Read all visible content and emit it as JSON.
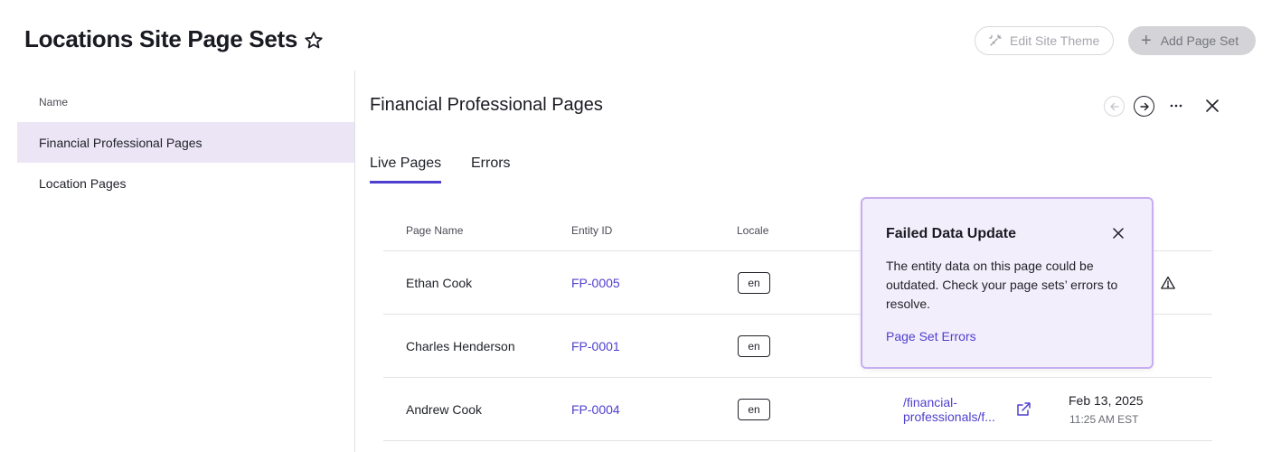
{
  "header": {
    "title": "Locations Site Page Sets",
    "edit_theme_label": "Edit Site Theme",
    "add_page_set_label": "Add Page Set"
  },
  "sidebar": {
    "column_header": "Name",
    "items": [
      {
        "label": "Financial Professional Pages",
        "active": true
      },
      {
        "label": "Location Pages",
        "active": false
      }
    ]
  },
  "panel": {
    "title": "Financial Professional Pages",
    "tabs": [
      {
        "label": "Live Pages",
        "active": true
      },
      {
        "label": "Errors",
        "active": false
      }
    ],
    "table": {
      "columns": [
        "Page Name",
        "Entity ID",
        "Locale"
      ],
      "rows": [
        {
          "page_name": "Ethan Cook",
          "entity_id": "FP-0005",
          "locale": "en"
        },
        {
          "page_name": "Charles Henderson",
          "entity_id": "FP-0001",
          "locale": "en"
        },
        {
          "page_name": "Andrew Cook",
          "entity_id": "FP-0004",
          "locale": "en",
          "url": "/financial-",
          "url_line2": "professionals/f...",
          "date": "Feb 13, 2025",
          "time": "11:25 AM EST"
        }
      ]
    }
  },
  "popover": {
    "title": "Failed Data Update",
    "body": "The entity data on this page could be outdated. Check your page sets’ errors to resolve.",
    "link_label": "Page Set Errors"
  },
  "colors": {
    "accent": "#4e3fcf",
    "sidebar_active": "#ebe5f5",
    "popover_bg": "#f3eefb",
    "popover_border": "#c7aef0"
  }
}
